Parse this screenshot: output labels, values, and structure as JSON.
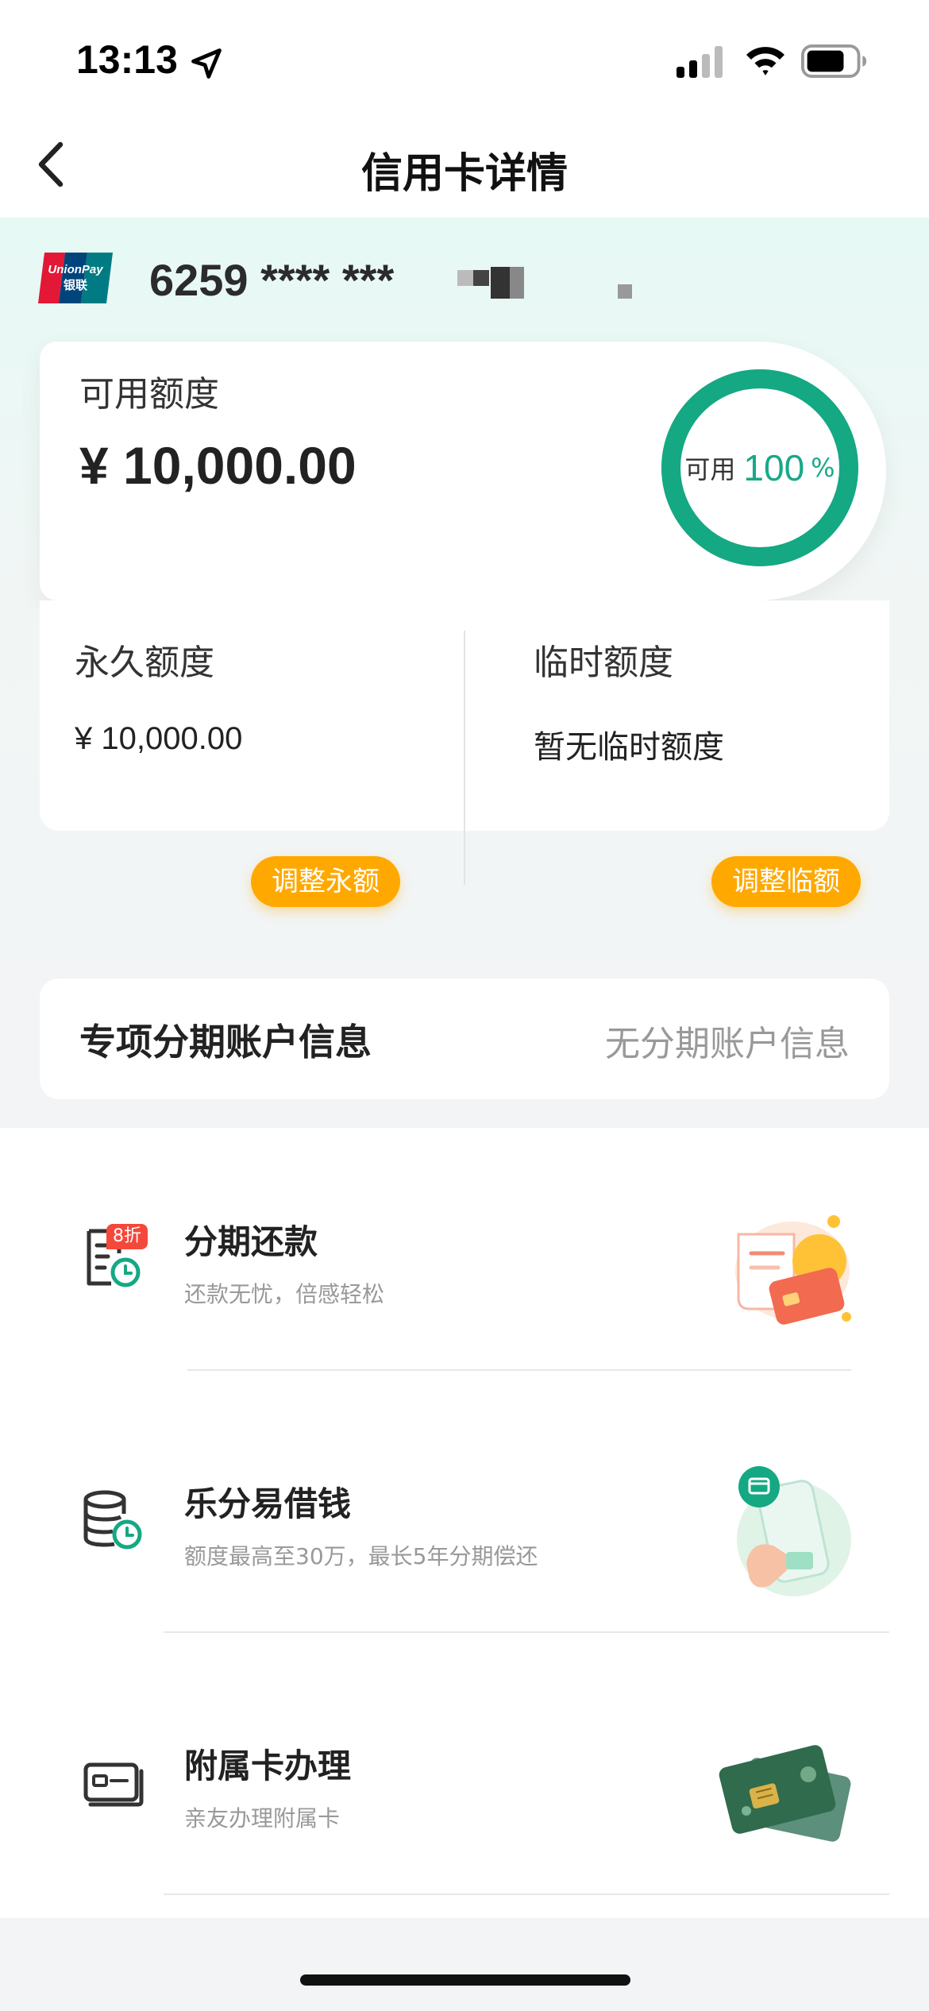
{
  "status_bar": {
    "time": "13:13",
    "icons": [
      "location-arrow-icon",
      "cellular-signal-icon",
      "wifi-icon",
      "battery-icon"
    ]
  },
  "nav": {
    "title": "信用卡详情",
    "back_icon": "chevron-left-icon"
  },
  "card": {
    "brand_logo": "unionpay-logo",
    "number_masked": "6259 **** ***"
  },
  "available": {
    "label": "可用额度",
    "amount": "¥ 10,000.00",
    "ring_prefix": "可用",
    "ring_value": "100",
    "ring_unit": "%",
    "ring_fraction": 1.0,
    "ring_color": "#14a883"
  },
  "limits": {
    "permanent": {
      "title": "永久额度",
      "value": "¥ 10,000.00",
      "button": "调整永额"
    },
    "temporary": {
      "title": "临时额度",
      "value": "暂无临时额度",
      "button": "调整临额"
    },
    "button_color": "#ffa900"
  },
  "installment_account": {
    "title": "专项分期账户信息",
    "status": "无分期账户信息"
  },
  "services": [
    {
      "icon": "bill-clock-icon",
      "badge": "8折",
      "title": "分期还款",
      "subtitle": "还款无忧，倍感轻松",
      "illustration": "receipt-card-illustration"
    },
    {
      "icon": "coin-stack-clock-icon",
      "title": "乐分易借钱",
      "subtitle": "额度最高至30万，最长5年分期偿还",
      "illustration": "phone-cash-illustration"
    },
    {
      "icon": "card-outline-icon",
      "title": "附属卡办理",
      "subtitle": "亲友办理附属卡",
      "illustration": "credit-cards-illustration"
    }
  ],
  "colors": {
    "accent_green": "#14a883",
    "accent_orange": "#ffa900",
    "badge_red": "#f4483b"
  }
}
